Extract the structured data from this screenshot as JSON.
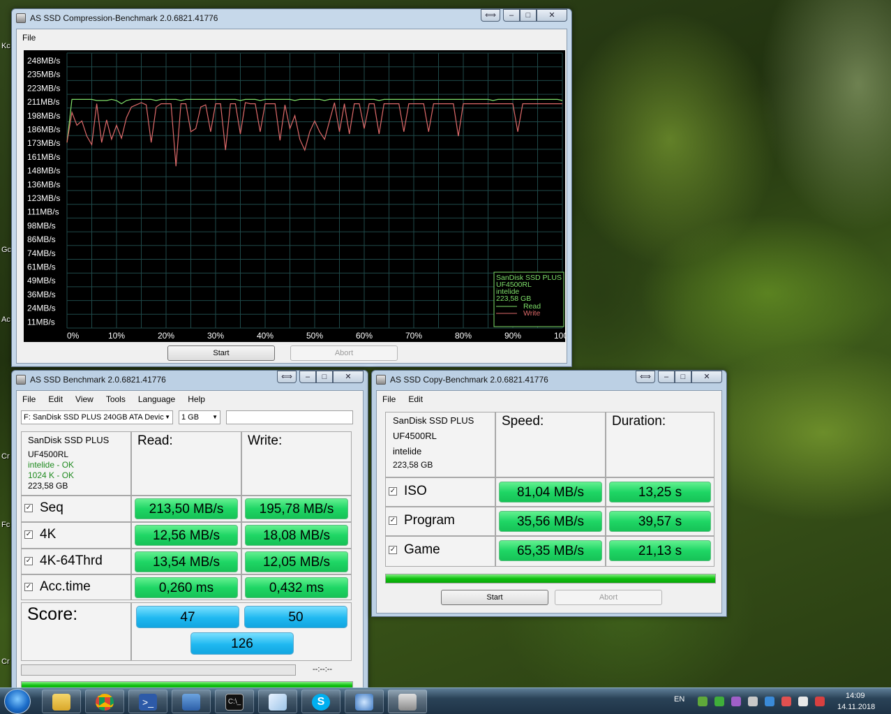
{
  "desktop": {
    "edge_labels": [
      "Kc",
      "Gc",
      "Ac",
      "Cr",
      "Fc",
      "Cr"
    ]
  },
  "compression_window": {
    "title": "AS SSD Compression-Benchmark 2.0.6821.41776",
    "menu": [
      "File"
    ],
    "title_buttons": {
      "restore": "⟺",
      "minimize": "‒",
      "maximize": "□",
      "close": "✕"
    },
    "chart_data": {
      "type": "line",
      "y_tick_labels": [
        "248MB/s",
        "235MB/s",
        "223MB/s",
        "211MB/s",
        "198MB/s",
        "186MB/s",
        "173MB/s",
        "161MB/s",
        "148MB/s",
        "136MB/s",
        "123MB/s",
        "111MB/s",
        "98MB/s",
        "86MB/s",
        "74MB/s",
        "61MB/s",
        "49MB/s",
        "36MB/s",
        "24MB/s",
        "11MB/s"
      ],
      "x_tick_labels": [
        "0%",
        "10%",
        "20%",
        "30%",
        "40%",
        "50%",
        "60%",
        "70%",
        "80%",
        "90%",
        "100%"
      ],
      "ylim": [
        0,
        255
      ],
      "grid": true,
      "legend_placement": "bottom-right",
      "legend_info": [
        "SanDisk SSD PLUS",
        "UF4500RL",
        "intelide",
        "223,58 GB"
      ],
      "series": [
        {
          "name": "Read",
          "color": "#7fe06a",
          "x": [
            0,
            1,
            2,
            3,
            4,
            5,
            6,
            7,
            8,
            9,
            10,
            11,
            12,
            13,
            14,
            15,
            16,
            17,
            18,
            19,
            20,
            21,
            22,
            23,
            24,
            25,
            26,
            27,
            28,
            29,
            30,
            31,
            32,
            33,
            34,
            35,
            36,
            37,
            38,
            39,
            40,
            41,
            42,
            43,
            44,
            45,
            46,
            47,
            48,
            49,
            50,
            51,
            52,
            53,
            54,
            55,
            56,
            57,
            58,
            59,
            60,
            61,
            62,
            63,
            64,
            65,
            66,
            67,
            68,
            69,
            70,
            71,
            72,
            73,
            74,
            75,
            76,
            77,
            78,
            79,
            80,
            81,
            82,
            83,
            84,
            85,
            86,
            87,
            88,
            89,
            90,
            91,
            92,
            93,
            94,
            95,
            96,
            97,
            98,
            99,
            100
          ],
          "values": [
            172,
            212,
            212,
            212,
            212,
            212,
            211,
            211,
            211,
            212,
            211,
            208,
            211,
            212,
            212,
            212,
            212,
            212,
            211,
            212,
            212,
            212,
            212,
            211,
            212,
            212,
            212,
            212,
            212,
            212,
            212,
            212,
            212,
            212,
            212,
            211,
            212,
            212,
            212,
            211,
            212,
            212,
            212,
            212,
            212,
            212,
            211,
            212,
            212,
            212,
            212,
            212,
            211,
            212,
            212,
            212,
            212,
            212,
            212,
            212,
            212,
            212,
            212,
            211,
            212,
            212,
            212,
            212,
            212,
            212,
            212,
            212,
            212,
            212,
            212,
            212,
            212,
            212,
            212,
            212,
            212,
            212,
            212,
            212,
            212,
            212,
            211,
            212,
            212,
            212,
            212,
            212,
            212,
            212,
            212,
            212,
            212,
            212,
            212,
            212,
            211
          ]
        },
        {
          "name": "Write",
          "color": "#e06b6b",
          "x": [
            0,
            1,
            2,
            3,
            4,
            5,
            6,
            7,
            8,
            9,
            10,
            11,
            12,
            13,
            14,
            15,
            16,
            17,
            18,
            19,
            20,
            21,
            22,
            23,
            24,
            25,
            26,
            27,
            28,
            29,
            30,
            31,
            32,
            33,
            34,
            35,
            36,
            37,
            38,
            39,
            40,
            41,
            42,
            43,
            44,
            45,
            46,
            47,
            48,
            49,
            50,
            51,
            52,
            53,
            54,
            55,
            56,
            57,
            58,
            59,
            60,
            61,
            62,
            63,
            64,
            65,
            66,
            67,
            68,
            69,
            70,
            71,
            72,
            73,
            74,
            75,
            76,
            77,
            78,
            79,
            80,
            81,
            82,
            83,
            84,
            85,
            86,
            87,
            88,
            89,
            90,
            91,
            92,
            93,
            94,
            95,
            96,
            97,
            98,
            99,
            100
          ],
          "values": [
            172,
            200,
            188,
            192,
            178,
            170,
            208,
            172,
            193,
            175,
            188,
            176,
            195,
            205,
            207,
            209,
            207,
            172,
            205,
            208,
            208,
            208,
            150,
            208,
            208,
            182,
            185,
            205,
            207,
            182,
            208,
            208,
            165,
            208,
            208,
            180,
            209,
            208,
            208,
            182,
            208,
            208,
            208,
            174,
            207,
            185,
            197,
            175,
            165,
            182,
            192,
            182,
            175,
            192,
            209,
            182,
            208,
            180,
            208,
            208,
            185,
            208,
            208,
            180,
            208,
            208,
            208,
            208,
            182,
            208,
            208,
            208,
            208,
            182,
            208,
            208,
            208,
            208,
            208,
            178,
            208,
            208,
            208,
            208,
            208,
            208,
            208,
            208,
            208,
            208,
            208,
            182,
            208,
            208,
            208,
            208,
            208,
            208,
            208,
            208,
            208
          ]
        }
      ]
    },
    "buttons": {
      "start": "Start",
      "abort": "Abort"
    }
  },
  "benchmark_window": {
    "title": "AS SSD Benchmark 2.0.6821.41776",
    "menu": [
      "File",
      "Edit",
      "View",
      "Tools",
      "Language",
      "Help"
    ],
    "title_buttons": {
      "restore": "⟺",
      "minimize": "‒",
      "maximize": "□",
      "close": "✕"
    },
    "drive_select": "F: SanDisk SSD PLUS 240GB ATA Devic",
    "size_select": "1 GB",
    "info": {
      "model": "SanDisk SSD PLUS",
      "firmware": "UF4500RL",
      "driver": "intelide - OK",
      "alignment": "1024 K - OK",
      "capacity": "223,58 GB"
    },
    "headers": {
      "read": "Read:",
      "write": "Write:"
    },
    "rows": [
      {
        "label": "Seq",
        "read": "213,50 MB/s",
        "write": "195,78 MB/s",
        "checked": true
      },
      {
        "label": "4K",
        "read": "12,56 MB/s",
        "write": "18,08 MB/s",
        "checked": true
      },
      {
        "label": "4K-64Thrd",
        "read": "13,54 MB/s",
        "write": "12,05 MB/s",
        "checked": true
      },
      {
        "label": "Acc.time",
        "read": "0,260 ms",
        "write": "0,432 ms",
        "checked": true
      }
    ],
    "score_label": "Score:",
    "score": {
      "read": "47",
      "write": "50",
      "total": "126"
    },
    "progress_text": "--:--:--"
  },
  "copy_window": {
    "title": "AS SSD Copy-Benchmark 2.0.6821.41776",
    "menu": [
      "File",
      "Edit"
    ],
    "title_buttons": {
      "restore": "⟺",
      "minimize": "‒",
      "maximize": "□",
      "close": "✕"
    },
    "info": {
      "model": "SanDisk SSD PLUS",
      "firmware": "UF4500RL",
      "driver": "intelide",
      "capacity": "223,58 GB"
    },
    "headers": {
      "speed": "Speed:",
      "duration": "Duration:"
    },
    "rows": [
      {
        "label": "ISO",
        "speed": "81,04 MB/s",
        "duration": "13,25 s",
        "checked": true
      },
      {
        "label": "Program",
        "speed": "35,56 MB/s",
        "duration": "39,57 s",
        "checked": true
      },
      {
        "label": "Game",
        "speed": "65,35 MB/s",
        "duration": "21,13 s",
        "checked": true
      }
    ],
    "progress": 1.0,
    "buttons": {
      "start": "Start",
      "abort": "Abort"
    }
  },
  "taskbar": {
    "language": "EN",
    "time": "14:09",
    "date": "14.11.2018",
    "pinned": [
      "explorer-icon",
      "chrome-icon",
      "powershell-icon",
      "powershell-ise-icon",
      "cmd-icon",
      "notepad-icon",
      "skype-icon",
      "network-tool-icon",
      "as-ssd-icon"
    ]
  }
}
